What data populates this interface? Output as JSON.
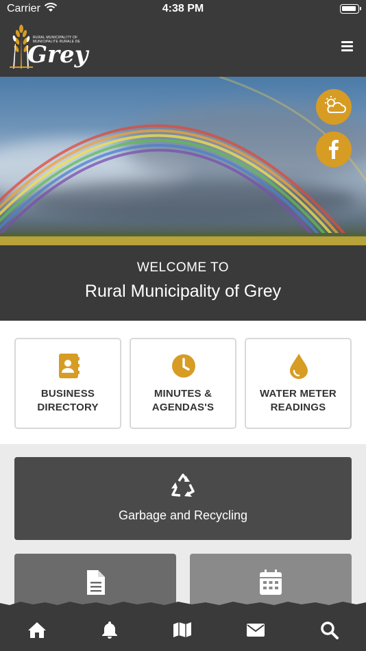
{
  "status_bar": {
    "carrier": "Carrier",
    "time": "4:38 PM"
  },
  "header": {
    "logo_text": "Grey",
    "logo_subtext_line1": "RURAL MUNICIPALITY OF",
    "logo_subtext_line2": "MUNICIPALITE RURALE DE"
  },
  "hero": {
    "buttons": [
      {
        "icon": "weather-icon"
      },
      {
        "icon": "facebook-icon"
      }
    ]
  },
  "welcome": {
    "line1": "WELCOME TO",
    "line2": "Rural Municipality of Grey"
  },
  "quick_links": [
    {
      "label": "BUSINESS DIRECTORY",
      "icon": "address-book-icon"
    },
    {
      "label": "MINUTES & AGENDAS'S",
      "icon": "clock-icon"
    },
    {
      "label": "WATER METER READINGS",
      "icon": "water-drop-icon"
    }
  ],
  "cards": {
    "main": {
      "label": "Garbage and Recycling",
      "icon": "recycle-icon"
    },
    "secondary": [
      {
        "icon": "document-icon"
      },
      {
        "icon": "calendar-icon"
      }
    ]
  },
  "bottom_nav": [
    {
      "icon": "home-icon"
    },
    {
      "icon": "bell-icon"
    },
    {
      "icon": "map-icon"
    },
    {
      "icon": "envelope-icon"
    },
    {
      "icon": "search-icon"
    }
  ],
  "colors": {
    "dark": "#3a3a3a",
    "accent": "#d79c24",
    "card_dark": "#4a4a4a",
    "card_mid": "#6b6b6b",
    "card_light": "#8a8a8a"
  }
}
